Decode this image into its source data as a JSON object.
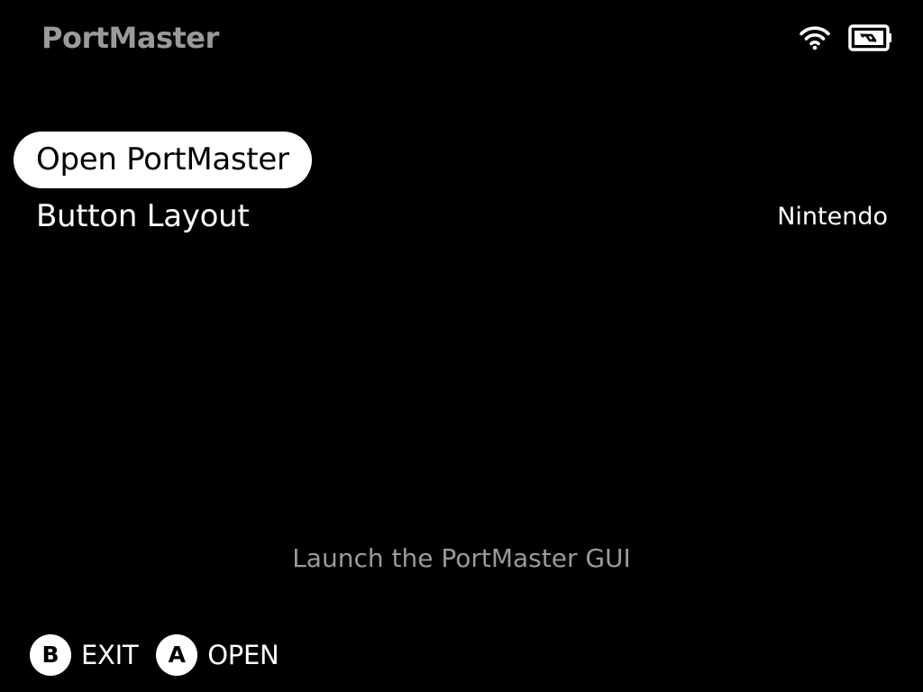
{
  "header": {
    "title": "PortMaster",
    "wifi_icon": "wifi-icon",
    "battery_icon": "battery-charging-icon"
  },
  "menu": {
    "items": [
      {
        "label": "Open PortMaster",
        "value": "",
        "selected": true
      },
      {
        "label": "Button Layout",
        "value": "Nintendo",
        "selected": false
      }
    ]
  },
  "description": "Launch the PortMaster GUI",
  "hints": [
    {
      "button": "B",
      "label": "EXIT"
    },
    {
      "button": "A",
      "label": "OPEN"
    }
  ],
  "colors": {
    "background": "#000000",
    "primary_text": "#ffffff",
    "secondary_text": "#9a9a9a",
    "highlight": "#ffffff"
  }
}
